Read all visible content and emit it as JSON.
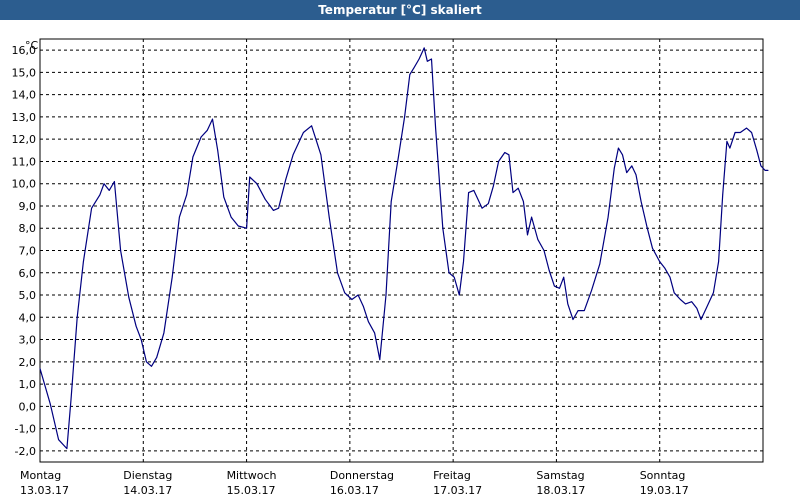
{
  "window": {
    "title": "Temperatur [°C] skaliert"
  },
  "chart_data": {
    "type": "line",
    "title": "Temperatur [°C] skaliert",
    "ylabel": "°C",
    "ylim": [
      -2.5,
      16.5
    ],
    "yticks": [
      "16,0",
      "15,0",
      "14,0",
      "13,0",
      "12,0",
      "11,0",
      "10,0",
      "9,0",
      "8,0",
      "7,0",
      "6,0",
      "5,0",
      "4,0",
      "3,0",
      "2,0",
      "1,0",
      "0,0",
      "-1,0",
      "-2,0"
    ],
    "grid": true,
    "days": [
      {
        "day": "Montag",
        "date": "13.03.17"
      },
      {
        "day": "Dienstag",
        "date": "14.03.17"
      },
      {
        "day": "Mittwoch",
        "date": "15.03.17"
      },
      {
        "day": "Donnerstag",
        "date": "16.03.17"
      },
      {
        "day": "Freitag",
        "date": "17.03.17"
      },
      {
        "day": "Samstag",
        "date": "18.03.17"
      },
      {
        "day": "Sonntag",
        "date": "19.03.17"
      }
    ],
    "series": [
      {
        "color": "#000080",
        "points": [
          [
            0.0,
            1.7
          ],
          [
            0.1,
            0.1
          ],
          [
            0.18,
            -1.5
          ],
          [
            0.26,
            -1.9
          ],
          [
            0.3,
            0.3
          ],
          [
            0.36,
            4.0
          ],
          [
            0.42,
            6.5
          ],
          [
            0.5,
            8.9
          ],
          [
            0.58,
            9.5
          ],
          [
            0.62,
            10.0
          ],
          [
            0.67,
            9.7
          ],
          [
            0.72,
            10.1
          ],
          [
            0.78,
            7.0
          ],
          [
            0.86,
            4.9
          ],
          [
            0.93,
            3.6
          ],
          [
            0.98,
            3.0
          ],
          [
            1.03,
            2.0
          ],
          [
            1.08,
            1.8
          ],
          [
            1.13,
            2.2
          ],
          [
            1.2,
            3.3
          ],
          [
            1.28,
            5.8
          ],
          [
            1.35,
            8.5
          ],
          [
            1.42,
            9.5
          ],
          [
            1.48,
            11.2
          ],
          [
            1.56,
            12.1
          ],
          [
            1.62,
            12.4
          ],
          [
            1.67,
            12.9
          ],
          [
            1.72,
            11.5
          ],
          [
            1.78,
            9.4
          ],
          [
            1.85,
            8.5
          ],
          [
            1.92,
            8.1
          ],
          [
            2.0,
            8.0
          ],
          [
            2.03,
            10.3
          ],
          [
            2.1,
            10.0
          ],
          [
            2.18,
            9.3
          ],
          [
            2.26,
            8.8
          ],
          [
            2.31,
            8.9
          ],
          [
            2.38,
            10.2
          ],
          [
            2.45,
            11.3
          ],
          [
            2.55,
            12.3
          ],
          [
            2.63,
            12.6
          ],
          [
            2.72,
            11.3
          ],
          [
            2.8,
            8.5
          ],
          [
            2.88,
            6.0
          ],
          [
            2.95,
            5.1
          ],
          [
            3.02,
            4.8
          ],
          [
            3.08,
            5.0
          ],
          [
            3.13,
            4.5
          ],
          [
            3.18,
            3.8
          ],
          [
            3.24,
            3.3
          ],
          [
            3.29,
            2.1
          ],
          [
            3.35,
            5.0
          ],
          [
            3.4,
            9.2
          ],
          [
            3.47,
            11.2
          ],
          [
            3.53,
            13.0
          ],
          [
            3.58,
            14.9
          ],
          [
            3.62,
            15.2
          ],
          [
            3.67,
            15.6
          ],
          [
            3.72,
            16.1
          ],
          [
            3.75,
            15.5
          ],
          [
            3.79,
            15.6
          ],
          [
            3.83,
            12.5
          ],
          [
            3.9,
            8.0
          ],
          [
            3.96,
            6.0
          ],
          [
            4.01,
            5.8
          ],
          [
            4.06,
            5.0
          ],
          [
            4.1,
            6.5
          ],
          [
            4.15,
            9.6
          ],
          [
            4.2,
            9.7
          ],
          [
            4.28,
            8.9
          ],
          [
            4.34,
            9.1
          ],
          [
            4.39,
            9.9
          ],
          [
            4.44,
            11.0
          ],
          [
            4.5,
            11.4
          ],
          [
            4.54,
            11.3
          ],
          [
            4.58,
            9.6
          ],
          [
            4.63,
            9.8
          ],
          [
            4.68,
            9.2
          ],
          [
            4.72,
            7.7
          ],
          [
            4.76,
            8.5
          ],
          [
            4.82,
            7.5
          ],
          [
            4.88,
            7.0
          ],
          [
            4.93,
            6.1
          ],
          [
            4.98,
            5.4
          ],
          [
            5.03,
            5.3
          ],
          [
            5.07,
            5.8
          ],
          [
            5.11,
            4.6
          ],
          [
            5.16,
            3.9
          ],
          [
            5.21,
            4.3
          ],
          [
            5.27,
            4.3
          ],
          [
            5.34,
            5.2
          ],
          [
            5.42,
            6.4
          ],
          [
            5.5,
            8.5
          ],
          [
            5.56,
            10.7
          ],
          [
            5.6,
            11.6
          ],
          [
            5.64,
            11.3
          ],
          [
            5.68,
            10.5
          ],
          [
            5.73,
            10.8
          ],
          [
            5.77,
            10.4
          ],
          [
            5.82,
            9.2
          ],
          [
            5.88,
            8.0
          ],
          [
            5.93,
            7.1
          ],
          [
            6.0,
            6.5
          ],
          [
            6.05,
            6.2
          ],
          [
            6.1,
            5.8
          ],
          [
            6.14,
            5.1
          ],
          [
            6.2,
            4.8
          ],
          [
            6.25,
            4.6
          ],
          [
            6.31,
            4.7
          ],
          [
            6.36,
            4.4
          ],
          [
            6.4,
            3.9
          ],
          [
            6.45,
            4.4
          ],
          [
            6.52,
            5.1
          ],
          [
            6.57,
            6.5
          ],
          [
            6.61,
            9.5
          ],
          [
            6.65,
            11.9
          ],
          [
            6.68,
            11.6
          ],
          [
            6.73,
            12.3
          ],
          [
            6.78,
            12.3
          ],
          [
            6.84,
            12.5
          ],
          [
            6.89,
            12.3
          ],
          [
            6.94,
            11.5
          ],
          [
            6.98,
            10.8
          ],
          [
            7.02,
            10.6
          ],
          [
            7.05,
            10.6
          ]
        ]
      }
    ]
  }
}
